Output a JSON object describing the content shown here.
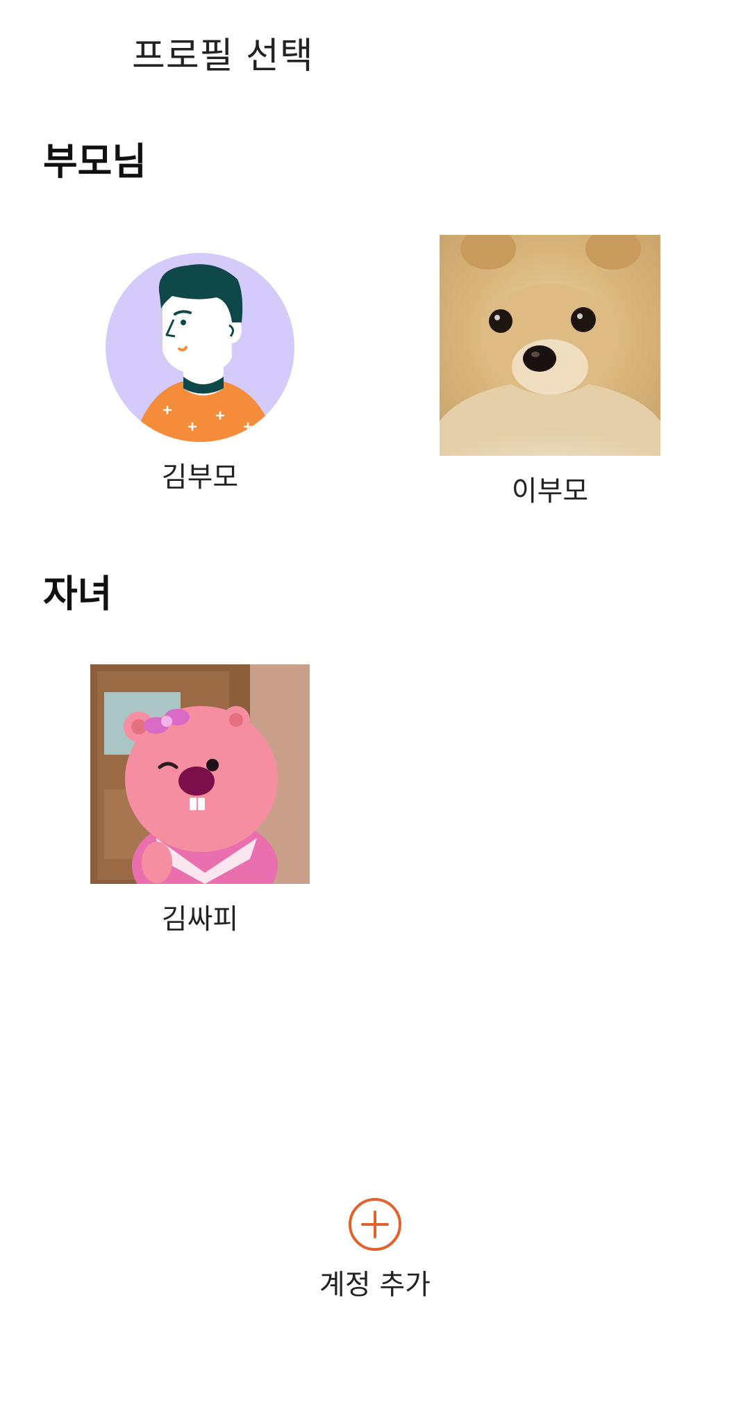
{
  "header": {
    "title": "프로필 선택"
  },
  "sections": [
    {
      "title": "부모님",
      "profiles": [
        {
          "name": "김부모",
          "avatar": "illustrated-man-avatar"
        },
        {
          "name": "이부모",
          "avatar": "pomeranian-dog-photo"
        }
      ]
    },
    {
      "title": "자녀",
      "profiles": [
        {
          "name": "김싸피",
          "avatar": "pink-beaver-character-photo"
        }
      ]
    }
  ],
  "add_account": {
    "label": "계정 추가",
    "icon": "plus-circle-icon",
    "color": "#E2622D"
  }
}
